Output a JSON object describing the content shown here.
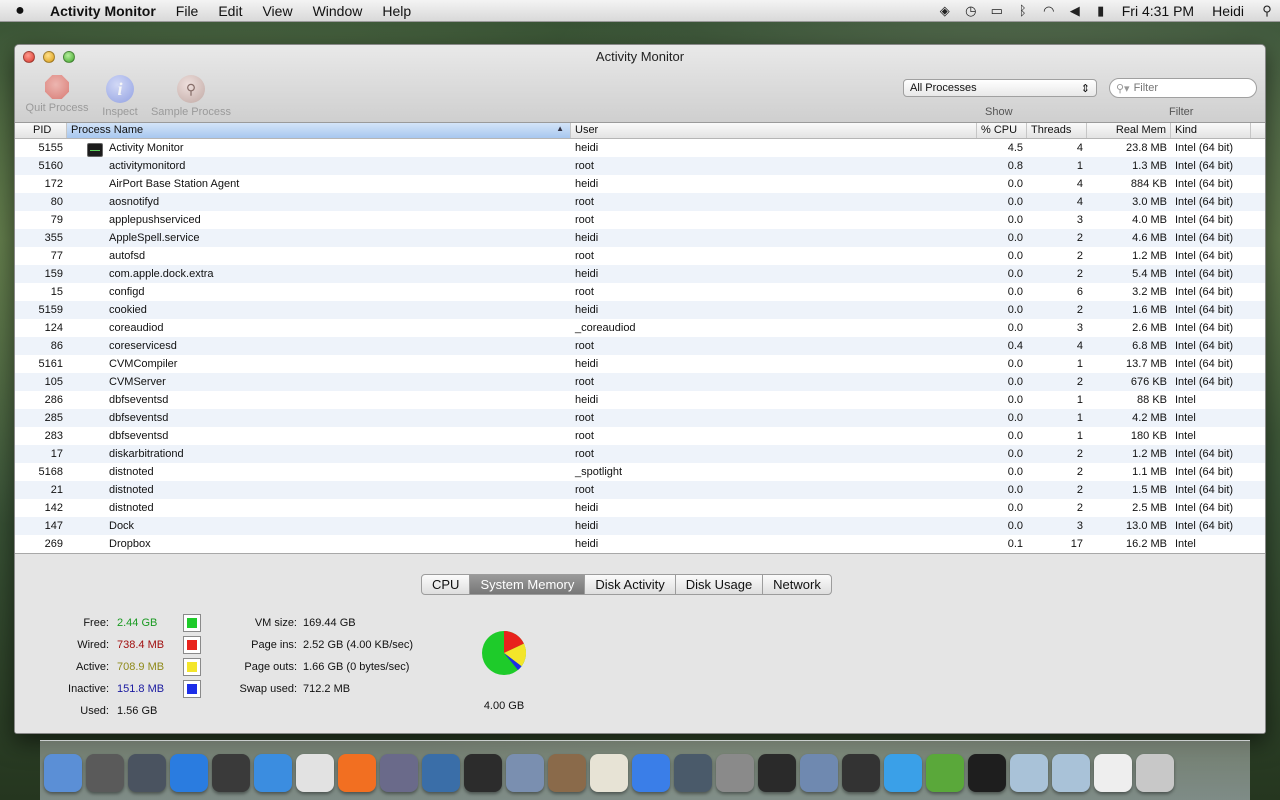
{
  "menubar": {
    "app_name": "Activity Monitor",
    "menus": [
      "File",
      "Edit",
      "View",
      "Window",
      "Help"
    ],
    "clock": "Fri 4:31 PM",
    "user": "Heidi"
  },
  "window": {
    "title": "Activity Monitor",
    "toolbar": {
      "quit_label": "Quit Process",
      "inspect_label": "Inspect",
      "sample_label": "Sample Process",
      "show_value": "All Processes",
      "show_label": "Show",
      "filter_placeholder": "Filter",
      "filter_label": "Filter"
    }
  },
  "table": {
    "headers": {
      "pid": "PID",
      "name": "Process Name",
      "user": "User",
      "cpu": "% CPU",
      "threads": "Threads",
      "mem": "Real Mem",
      "kind": "Kind"
    },
    "rows": [
      {
        "pid": "5155",
        "name": "Activity Monitor",
        "user": "heidi",
        "cpu": "4.5",
        "threads": "4",
        "mem": "23.8 MB",
        "kind": "Intel (64 bit)"
      },
      {
        "pid": "5160",
        "name": "activitymonitord",
        "user": "root",
        "cpu": "0.8",
        "threads": "1",
        "mem": "1.3 MB",
        "kind": "Intel (64 bit)"
      },
      {
        "pid": "172",
        "name": "AirPort Base Station Agent",
        "user": "heidi",
        "cpu": "0.0",
        "threads": "4",
        "mem": "884 KB",
        "kind": "Intel (64 bit)"
      },
      {
        "pid": "80",
        "name": "aosnotifyd",
        "user": "root",
        "cpu": "0.0",
        "threads": "4",
        "mem": "3.0 MB",
        "kind": "Intel (64 bit)"
      },
      {
        "pid": "79",
        "name": "applepushserviced",
        "user": "root",
        "cpu": "0.0",
        "threads": "3",
        "mem": "4.0 MB",
        "kind": "Intel (64 bit)"
      },
      {
        "pid": "355",
        "name": "AppleSpell.service",
        "user": "heidi",
        "cpu": "0.0",
        "threads": "2",
        "mem": "4.6 MB",
        "kind": "Intel (64 bit)"
      },
      {
        "pid": "77",
        "name": "autofsd",
        "user": "root",
        "cpu": "0.0",
        "threads": "2",
        "mem": "1.2 MB",
        "kind": "Intel (64 bit)"
      },
      {
        "pid": "159",
        "name": "com.apple.dock.extra",
        "user": "heidi",
        "cpu": "0.0",
        "threads": "2",
        "mem": "5.4 MB",
        "kind": "Intel (64 bit)"
      },
      {
        "pid": "15",
        "name": "configd",
        "user": "root",
        "cpu": "0.0",
        "threads": "6",
        "mem": "3.2 MB",
        "kind": "Intel (64 bit)"
      },
      {
        "pid": "5159",
        "name": "cookied",
        "user": "heidi",
        "cpu": "0.0",
        "threads": "2",
        "mem": "1.6 MB",
        "kind": "Intel (64 bit)"
      },
      {
        "pid": "124",
        "name": "coreaudiod",
        "user": "_coreaudiod",
        "cpu": "0.0",
        "threads": "3",
        "mem": "2.6 MB",
        "kind": "Intel (64 bit)"
      },
      {
        "pid": "86",
        "name": "coreservicesd",
        "user": "root",
        "cpu": "0.4",
        "threads": "4",
        "mem": "6.8 MB",
        "kind": "Intel (64 bit)"
      },
      {
        "pid": "5161",
        "name": "CVMCompiler",
        "user": "heidi",
        "cpu": "0.0",
        "threads": "1",
        "mem": "13.7 MB",
        "kind": "Intel (64 bit)"
      },
      {
        "pid": "105",
        "name": "CVMServer",
        "user": "root",
        "cpu": "0.0",
        "threads": "2",
        "mem": "676 KB",
        "kind": "Intel (64 bit)"
      },
      {
        "pid": "286",
        "name": "dbfseventsd",
        "user": "heidi",
        "cpu": "0.0",
        "threads": "1",
        "mem": "88 KB",
        "kind": "Intel"
      },
      {
        "pid": "285",
        "name": "dbfseventsd",
        "user": "root",
        "cpu": "0.0",
        "threads": "1",
        "mem": "4.2 MB",
        "kind": "Intel"
      },
      {
        "pid": "283",
        "name": "dbfseventsd",
        "user": "root",
        "cpu": "0.0",
        "threads": "1",
        "mem": "180 KB",
        "kind": "Intel"
      },
      {
        "pid": "17",
        "name": "diskarbitrationd",
        "user": "root",
        "cpu": "0.0",
        "threads": "2",
        "mem": "1.2 MB",
        "kind": "Intel (64 bit)"
      },
      {
        "pid": "5168",
        "name": "distnoted",
        "user": "_spotlight",
        "cpu": "0.0",
        "threads": "2",
        "mem": "1.1 MB",
        "kind": "Intel (64 bit)"
      },
      {
        "pid": "21",
        "name": "distnoted",
        "user": "root",
        "cpu": "0.0",
        "threads": "2",
        "mem": "1.5 MB",
        "kind": "Intel (64 bit)"
      },
      {
        "pid": "142",
        "name": "distnoted",
        "user": "heidi",
        "cpu": "0.0",
        "threads": "2",
        "mem": "2.5 MB",
        "kind": "Intel (64 bit)"
      },
      {
        "pid": "147",
        "name": "Dock",
        "user": "heidi",
        "cpu": "0.0",
        "threads": "3",
        "mem": "13.0 MB",
        "kind": "Intel (64 bit)"
      },
      {
        "pid": "269",
        "name": "Dropbox",
        "user": "heidi",
        "cpu": "0.1",
        "threads": "17",
        "mem": "16.2 MB",
        "kind": "Intel"
      }
    ]
  },
  "bottom": {
    "tabs": [
      "CPU",
      "System Memory",
      "Disk Activity",
      "Disk Usage",
      "Network"
    ],
    "active_tab": "System Memory",
    "memory": {
      "free_label": "Free:",
      "free_value": "2.44 GB",
      "wired_label": "Wired:",
      "wired_value": "738.4 MB",
      "active_label": "Active:",
      "active_value": "708.9 MB",
      "inactive_label": "Inactive:",
      "inactive_value": "151.8 MB",
      "used_label": "Used:",
      "used_value": "1.56 GB"
    },
    "vm": {
      "vmsize_label": "VM size:",
      "vmsize_value": "169.44 GB",
      "pageins_label": "Page ins:",
      "pageins_value": "2.52 GB (4.00 KB/sec)",
      "pageouts_label": "Page outs:",
      "pageouts_value": "1.66 GB (0 bytes/sec)",
      "swap_label": "Swap used:",
      "swap_value": "712.2 MB"
    },
    "pie_total": "4.00 GB"
  },
  "colors": {
    "free": "#1ecb2a",
    "wired": "#e8231c",
    "active": "#f3e52a",
    "inactive": "#1c2ee8",
    "free_text": "#1a9a22",
    "wired_text": "#a11010",
    "active_text": "#8f8a1a",
    "inactive_text": "#1a1aa0"
  },
  "dock_icons": [
    "finder-icon",
    "photo-booth-icon",
    "launchpad-icon",
    "app-store-icon",
    "dashboard-icon",
    "safari-icon",
    "chrome-icon",
    "soundcloud-icon",
    "quill-icon",
    "preview-icon",
    "scrivener-icon",
    "iphoto-icon",
    "photo-icon",
    "fox-icon",
    "itunes-icon",
    "time-machine-icon",
    "system-preferences-icon",
    "final-cut-icon",
    "mail-icon",
    "circle-icon",
    "icloud-icon",
    "evernote-icon",
    "activity-monitor-icon",
    "documents-folder-icon",
    "applications-folder-icon",
    "browser-doc-icon",
    "trash-icon"
  ]
}
